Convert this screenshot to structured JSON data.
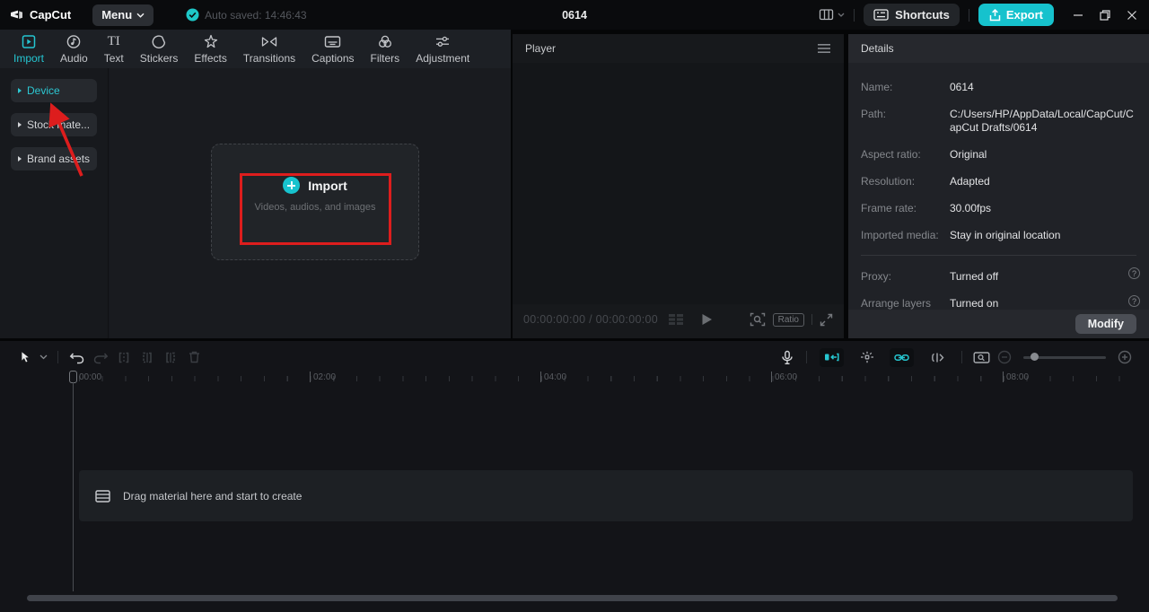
{
  "titlebar": {
    "app_name": "CapCut",
    "menu_label": "Menu",
    "autosave_text": "Auto saved: 14:46:43",
    "document_title": "0614",
    "shortcuts_label": "Shortcuts",
    "export_label": "Export"
  },
  "media_panel": {
    "tabs": [
      {
        "label": "Import"
      },
      {
        "label": "Audio"
      },
      {
        "label": "Text"
      },
      {
        "label": "Stickers"
      },
      {
        "label": "Effects"
      },
      {
        "label": "Transitions"
      },
      {
        "label": "Captions"
      },
      {
        "label": "Filters"
      },
      {
        "label": "Adjustment"
      }
    ],
    "active_tab": "Import",
    "sidebar": [
      {
        "label": "Device"
      },
      {
        "label": "Stock mate..."
      },
      {
        "label": "Brand assets"
      }
    ],
    "active_sidebar_item": "Device",
    "import_zone": {
      "title": "Import",
      "subtitle": "Videos, audios, and images"
    }
  },
  "player": {
    "title": "Player",
    "timecode": "00:00:00:00 / 00:00:00:00",
    "ratio_label": "Ratio"
  },
  "details": {
    "title": "Details",
    "rows": [
      {
        "label": "Name:",
        "value": "0614"
      },
      {
        "label": "Path:",
        "value": "C:/Users/HP/AppData/Local/CapCut/CapCut Drafts/0614"
      },
      {
        "label": "Aspect ratio:",
        "value": "Original"
      },
      {
        "label": "Resolution:",
        "value": "Adapted"
      },
      {
        "label": "Frame rate:",
        "value": "30.00fps"
      },
      {
        "label": "Imported media:",
        "value": "Stay in original location"
      }
    ],
    "toggle_rows": [
      {
        "label": "Proxy:",
        "value": "Turned off"
      },
      {
        "label": "Arrange layers",
        "value": "Turned on"
      }
    ],
    "modify_label": "Modify"
  },
  "timeline": {
    "ruler_labels": [
      "00:00",
      "02:00",
      "04:00",
      "06:00",
      "08:00"
    ],
    "empty_message": "Drag material here and start to create"
  },
  "icons": {
    "text_tab_glyph": "TI",
    "question_glyph": "?"
  },
  "annotations": {
    "color": "#dd1d1d",
    "note": "red box around Import button and red arrow pointing to Device"
  },
  "colors": {
    "accent_cyan": "#1ec4cf",
    "export_button": "#16c2cd",
    "annotation_red": "#dd1d1d"
  }
}
